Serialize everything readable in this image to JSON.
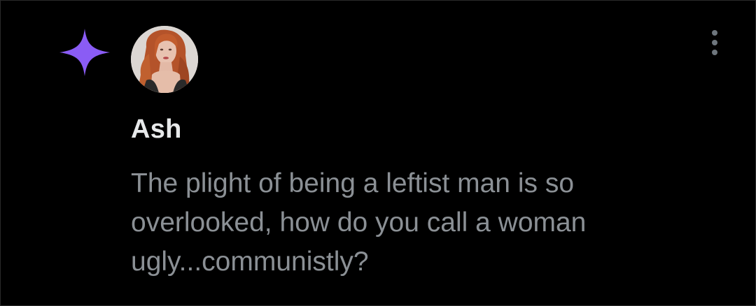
{
  "post": {
    "username": "Ash",
    "text": "The plight of being a leftist man is so overlooked, how do you call a woman ugly...communistly?"
  },
  "icons": {
    "badge": "sparkle-icon",
    "menu": "more-vertical-icon",
    "avatar": "profile-avatar"
  },
  "colors": {
    "background": "#000000",
    "sparkle": "#8a5cf5",
    "username": "#e7e9ea",
    "text": "#8b9095",
    "menu_dots": "#6e767d"
  }
}
